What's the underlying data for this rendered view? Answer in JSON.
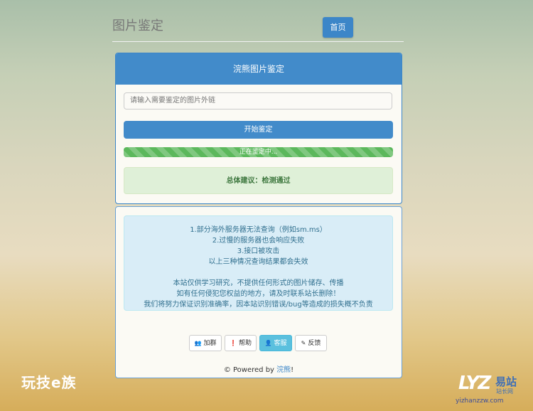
{
  "header": {
    "site_title": "图片鉴定",
    "home_button": "首页"
  },
  "panel": {
    "title": "浣熊图片鉴定",
    "input_placeholder": "请输入需要鉴定的图片外链",
    "start_button": "开始鉴定",
    "progress_text": "正在鉴定中...",
    "progress_percent": 100,
    "result_text": "总体建议：检测通过"
  },
  "info": {
    "lines_a": [
      "1.部分海外服务器无法查询（例如sm.ms）",
      "2.过慢的服务器也会响应失败",
      "3.接口被攻击",
      "以上三种情况查询结果都会失效"
    ],
    "lines_b": [
      "本站仅供学习研究，不提供任何形式的图片储存、传播",
      "如有任何侵犯您权益的地方，请及时联系站长删除！",
      "我们将努力保证识别准确率，因本站识别错误/bug等造成的损失概不负责"
    ]
  },
  "buttons": [
    {
      "label": "加群",
      "icon": "users-icon"
    },
    {
      "label": "帮助",
      "icon": "info-icon"
    },
    {
      "label": "客服",
      "icon": "user-icon"
    },
    {
      "label": "反馈",
      "icon": "pencil-icon"
    }
  ],
  "footer": {
    "prefix": "© Powered by",
    "link": "浣熊",
    "suffix": "!"
  },
  "watermarks": {
    "left": "玩技e族",
    "logo": "LYZ",
    "site_cn": "易站",
    "site_sub": "站长网",
    "url": "yizhanzzw.com"
  },
  "colors": {
    "primary": "#428bca",
    "success": "#5cb85c",
    "info_bg": "#d9edf7",
    "info_btn": "#5bc0de"
  }
}
